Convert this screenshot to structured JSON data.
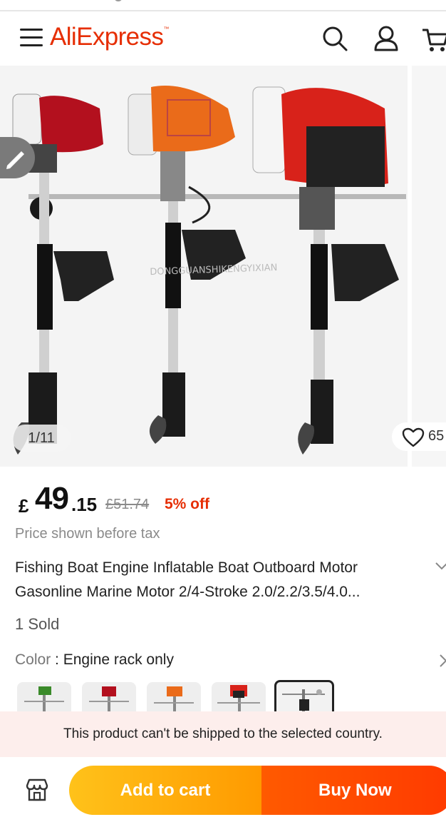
{
  "header": {
    "logo_text": "AliExpress",
    "logo_tm": "™",
    "brand_color": "#e62e04",
    "icons": [
      "menu-icon",
      "search-icon",
      "account-icon",
      "cart-icon"
    ]
  },
  "gallery": {
    "counter": "1/11",
    "wishlist_count": "65",
    "watermark": "DONGGUANSHIKENGYIXIAN"
  },
  "price": {
    "currency": "£",
    "integer": "49",
    "decimal": ".15",
    "original": "£51.74",
    "discount": "5% off",
    "tax_note": "Price shown before tax"
  },
  "product": {
    "title": "Fishing Boat Engine Inflatable Boat Outboard Motor Gasonline Marine Motor 2/4-Stroke 2.0/2.2/3.5/4.0...",
    "sold": "1 Sold",
    "color_label": "Color",
    "color_separator": " : ",
    "color_value": "Engine rack only",
    "swatch_count": 5,
    "selected_swatch": 5
  },
  "shipping": {
    "notice": "This product can't be shipped to the selected country."
  },
  "actions": {
    "add_to_cart": "Add to cart",
    "buy_now": "Buy Now",
    "store_icon": "store-icon"
  }
}
